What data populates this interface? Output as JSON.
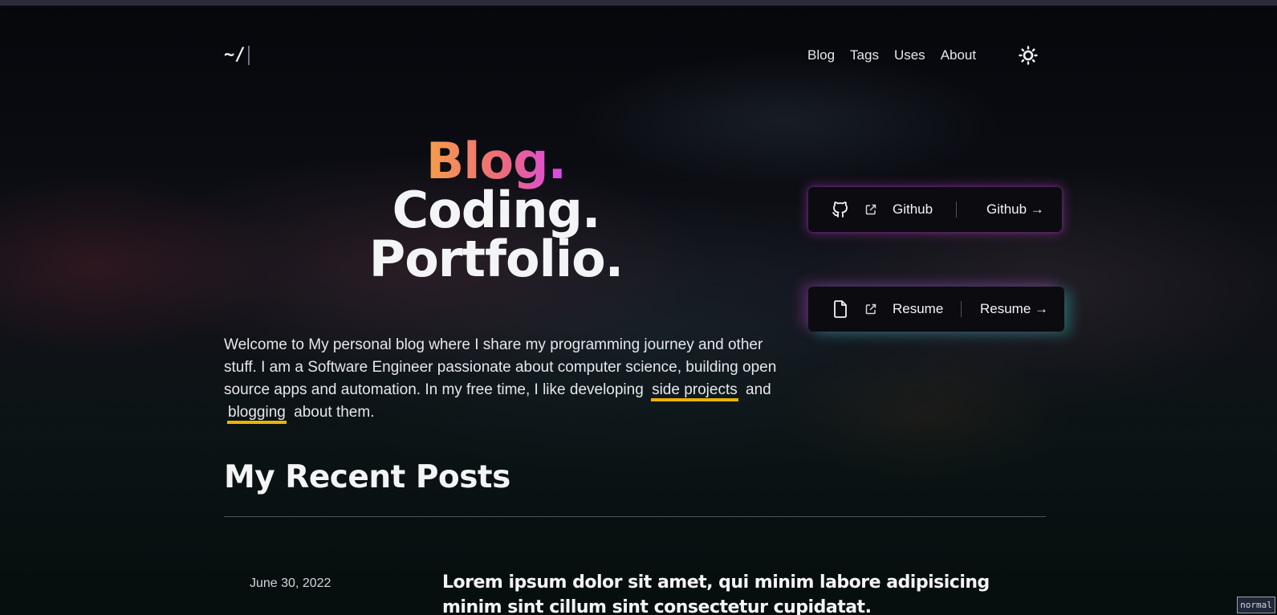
{
  "header": {
    "logo_text": "~/",
    "nav": [
      {
        "label": "Blog"
      },
      {
        "label": "Tags"
      },
      {
        "label": "Uses"
      },
      {
        "label": "About"
      }
    ],
    "theme_icon": "sun-icon"
  },
  "hero": {
    "line1": "Blog.",
    "line2": "Coding.",
    "line3": "Portfolio."
  },
  "intro": {
    "text_before": "Welcome to My personal blog where I share my programming journey and other stuff. I am a Software Engineer passionate about computer science, building open source apps and automation. In my free time, I like developing",
    "link1": "side projects",
    "text_middle": "and",
    "link2": "blogging",
    "text_after": "about them."
  },
  "cards": {
    "github": {
      "icon": "github-icon",
      "label": "Github",
      "cta": "Github →"
    },
    "resume": {
      "icon": "file-icon",
      "label": "Resume",
      "cta": "Resume →"
    }
  },
  "recent_posts": {
    "title": "My Recent Posts",
    "items": [
      {
        "date": "June 30, 2022",
        "title": "Lorem ipsum dolor sit amet, qui minim labore adipisicing minim sint cillum sint consectetur cupidatat."
      }
    ]
  },
  "status": {
    "mode": "normal"
  },
  "colors": {
    "accent_underline": "#eab308",
    "gradient_start": "#f59e4a",
    "gradient_end": "#d946ef",
    "glow_teal": "#2dd4bf"
  }
}
